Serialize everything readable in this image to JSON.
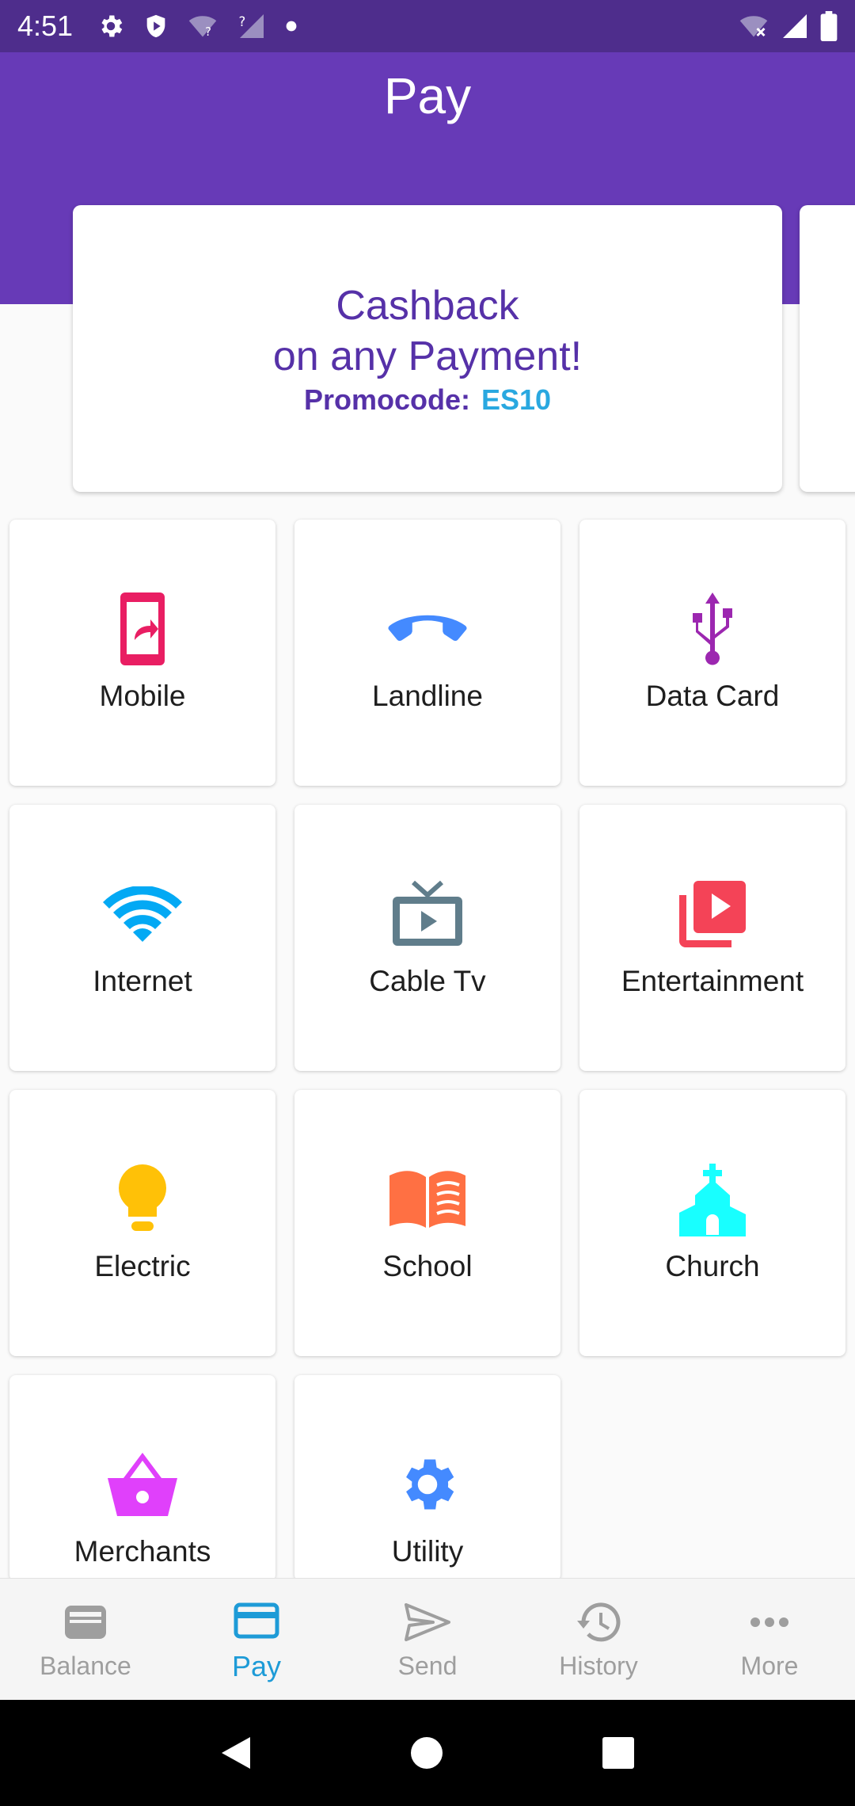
{
  "status_bar": {
    "time": "4:51",
    "icons_left": [
      "gear-icon",
      "shield-icon",
      "wifi-question-icon",
      "signal-question-icon",
      "dot-icon"
    ],
    "icons_right": [
      "wifi-off-icon",
      "signal-icon",
      "battery-icon"
    ]
  },
  "header": {
    "title": "Pay"
  },
  "promo": {
    "line1": "Cashback",
    "line2": "on any Payment!",
    "code_label": "Promocode:",
    "code_value": "ES10"
  },
  "categories": [
    {
      "label": "Mobile",
      "icon": "mobile-icon",
      "color": "#e91e63"
    },
    {
      "label": "Landline",
      "icon": "phone-hangup-icon",
      "color": "#448aff"
    },
    {
      "label": "Data Card",
      "icon": "usb-icon",
      "color": "#9c27b0"
    },
    {
      "label": "Internet",
      "icon": "wifi-icon",
      "color": "#03a9f4"
    },
    {
      "label": "Cable Tv",
      "icon": "tv-icon",
      "color": "#607d8b"
    },
    {
      "label": "Entertainment",
      "icon": "video-library-icon",
      "color": "#f44357"
    },
    {
      "label": "Electric",
      "icon": "lightbulb-icon",
      "color": "#ffc107"
    },
    {
      "label": "School",
      "icon": "book-icon",
      "color": "#ff7043"
    },
    {
      "label": "Church",
      "icon": "church-icon",
      "color": "#18ffff"
    },
    {
      "label": "Merchants",
      "icon": "basket-icon",
      "color": "#e040fb"
    },
    {
      "label": "Utility",
      "icon": "gear-icon",
      "color": "#448aff"
    }
  ],
  "bottom_nav": {
    "items": [
      {
        "label": "Balance",
        "icon": "wallet-icon",
        "active": false
      },
      {
        "label": "Pay",
        "icon": "credit-card-icon",
        "active": true
      },
      {
        "label": "Send",
        "icon": "send-icon",
        "active": false
      },
      {
        "label": "History",
        "icon": "history-icon",
        "active": false
      },
      {
        "label": "More",
        "icon": "more-horizontal-icon",
        "active": false
      }
    ]
  },
  "colors": {
    "status_bar": "#4e2d8c",
    "app_bar": "#673ab7",
    "promo_text": "#5631a8",
    "promo_code": "#29a8e0",
    "nav_active": "#1e9bd7",
    "nav_inactive": "#9e9e9e"
  }
}
